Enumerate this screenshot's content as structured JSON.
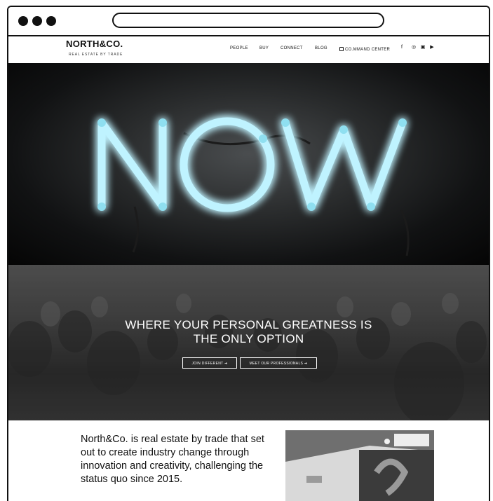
{
  "browser": {
    "url": ""
  },
  "nav": {
    "logo": "NORTH&CO.",
    "logo_sub": "REAL ESTATE BY TRADE",
    "items": [
      "PEOPLE",
      "BUY",
      "CONNECT",
      "BLOG",
      "CO.MMAND CENTER"
    ],
    "social": [
      {
        "icon": "facebook-icon",
        "glyph": "f"
      },
      {
        "icon": "instagram-icon",
        "glyph": "◎"
      },
      {
        "icon": "linkedin-icon",
        "glyph": "▣"
      },
      {
        "icon": "youtube-icon",
        "glyph": "▶"
      }
    ]
  },
  "hero": {
    "neon_word": "NOW",
    "tagline_line1": "WHERE YOUR PERSONAL GREATNESS IS",
    "tagline_line2": "THE ONLY OPTION",
    "cta_join": "JOIN DIFFERENT  ➔",
    "cta_meet": "MEET OUR PROFESSIONALS  ➔"
  },
  "about": {
    "text": "North&Co. is real estate by trade that set out to create industry change through innovation and creativity, challenging the status quo since 2015."
  },
  "colors": {
    "neon": "#bff3ff",
    "neon_glow": "#5fd6f0",
    "text_dark": "#111111"
  }
}
